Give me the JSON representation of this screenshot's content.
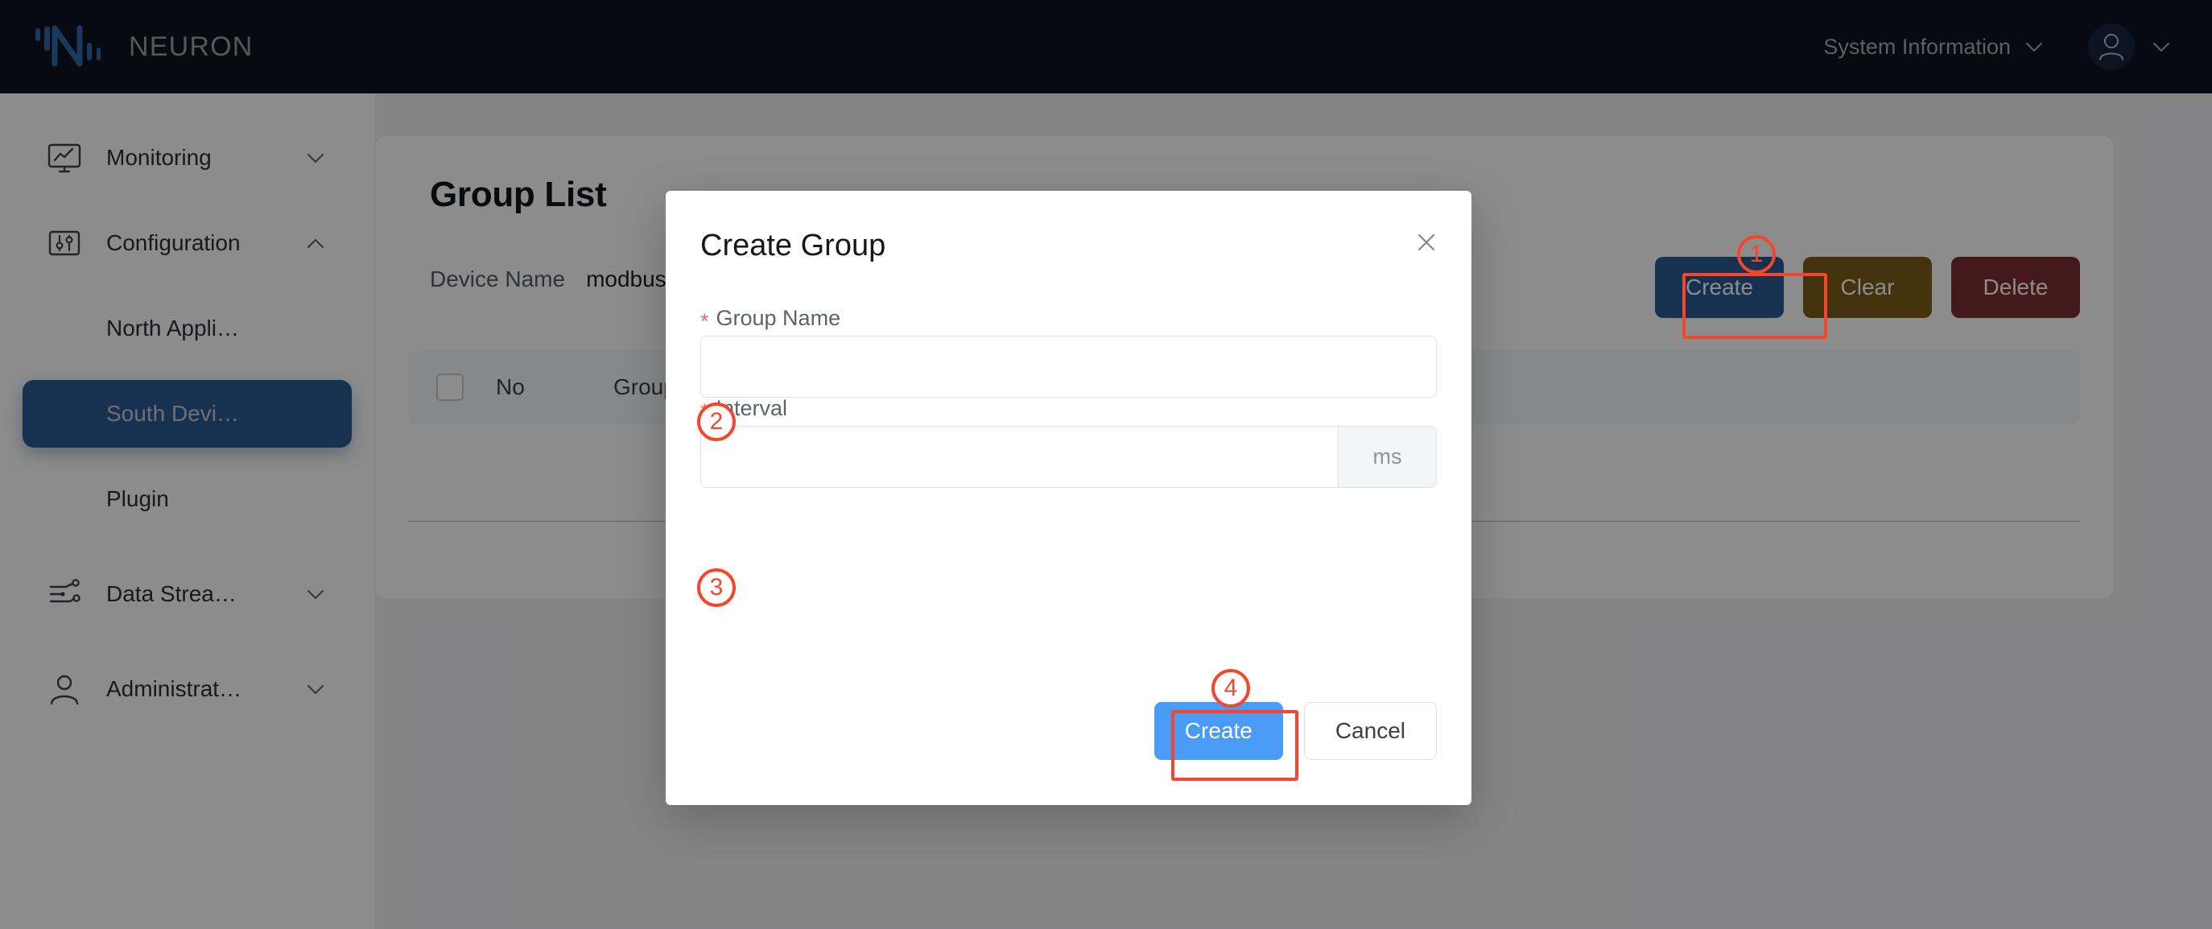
{
  "topbar": {
    "brand": "NEURON",
    "logo_icon": "neuron-logo-icon",
    "system_information": "System Information",
    "system_information_chevron": "chevron-down-icon",
    "avatar_icon": "user-avatar-icon",
    "avatar_chevron": "chevron-down-icon"
  },
  "sidebar": {
    "items": [
      {
        "label": "Monitoring",
        "icon": "monitor-icon",
        "chevron": "chevron-down-icon",
        "type": "parent",
        "expanded": false,
        "active": false
      },
      {
        "label": "Configuration",
        "icon": "sliders-icon",
        "chevron": "chevron-up-icon",
        "type": "parent",
        "expanded": true,
        "active": false
      },
      {
        "label": "North Appli…",
        "icon": "",
        "chevron": "",
        "type": "child",
        "expanded": false,
        "active": false
      },
      {
        "label": "South Devi…",
        "icon": "",
        "chevron": "",
        "type": "child",
        "expanded": false,
        "active": true
      },
      {
        "label": "Plugin",
        "icon": "",
        "chevron": "",
        "type": "child",
        "expanded": false,
        "active": false
      },
      {
        "label": "Data Strea…",
        "icon": "data-stream-icon",
        "chevron": "chevron-down-icon",
        "type": "parent",
        "expanded": false,
        "active": false
      },
      {
        "label": "Administrat…",
        "icon": "user-icon",
        "chevron": "chevron-down-icon",
        "type": "parent",
        "expanded": false,
        "active": false
      }
    ]
  },
  "page": {
    "title": "Group List",
    "filter": {
      "label": "Device Name",
      "value": "modbus"
    },
    "toolbar": {
      "create_label": "Create",
      "clear_label": "Clear",
      "delete_label": "Delete",
      "create_color": "#2b5c93",
      "clear_color": "#7b5c16",
      "delete_color": "#7d2f2f"
    },
    "table": {
      "select_all_checkbox": "select-all-checkbox",
      "columns": [
        "No",
        "Group N"
      ],
      "rows": []
    }
  },
  "modal": {
    "title": "Create Group",
    "close_icon": "close-icon",
    "fields": [
      {
        "label": "Group Name",
        "required_marker": "*",
        "value": "",
        "placeholder": ""
      },
      {
        "label": "Interval",
        "required_marker": "*",
        "value": "",
        "placeholder": "",
        "suffix": "ms"
      }
    ],
    "create_label": "Create",
    "cancel_label": "Cancel",
    "primary_color": "#4a9bf5"
  },
  "annotations": {
    "color": "#f4462c",
    "markers": [
      {
        "number": "1",
        "target": "page-toolbar-create-button"
      },
      {
        "number": "2",
        "target": "group-name-input"
      },
      {
        "number": "3",
        "target": "interval-input"
      },
      {
        "number": "4",
        "target": "modal-create-button"
      }
    ]
  }
}
